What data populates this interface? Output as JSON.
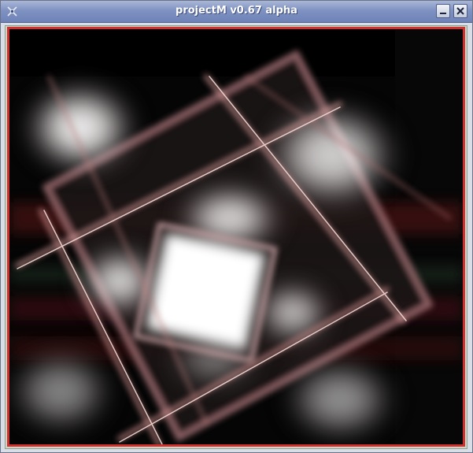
{
  "window": {
    "title": "projectM v0.67 alpha",
    "icons": {
      "app": "projectm-app-icon",
      "minimize": "minimize-icon",
      "close": "close-icon"
    }
  },
  "visualization": {
    "border_color": "#d2302e",
    "background_color": "#050505"
  }
}
